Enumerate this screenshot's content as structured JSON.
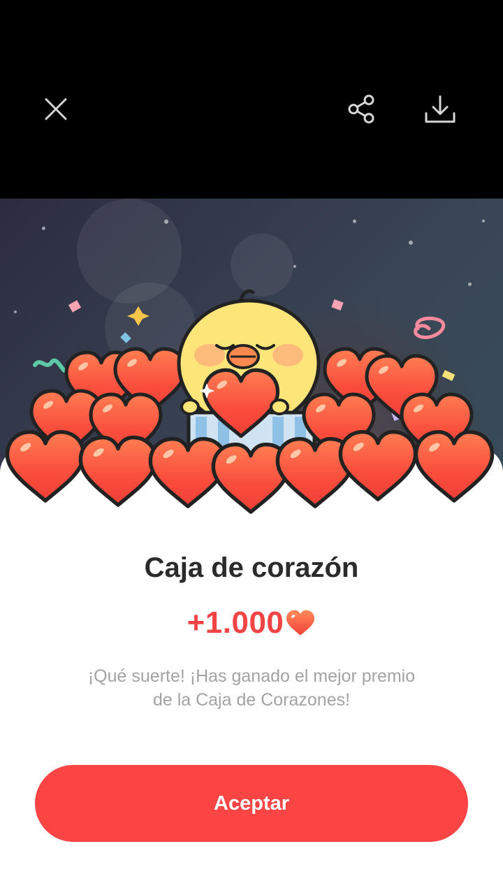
{
  "toolbar": {
    "close_icon": "close-icon",
    "share_icon": "share-icon",
    "download_icon": "download-icon"
  },
  "reward_card": {
    "title": "Caja de corazón",
    "amount": "+1.000",
    "message": "¡Qué suerte! ¡Has ganado el mejor premio de la Caja de Corazones!",
    "accept_label": "Aceptar"
  },
  "colors": {
    "accent": "#fb4545",
    "amount": "#f24444",
    "title": "#2b2b2b",
    "message": "#a3a3a3"
  }
}
